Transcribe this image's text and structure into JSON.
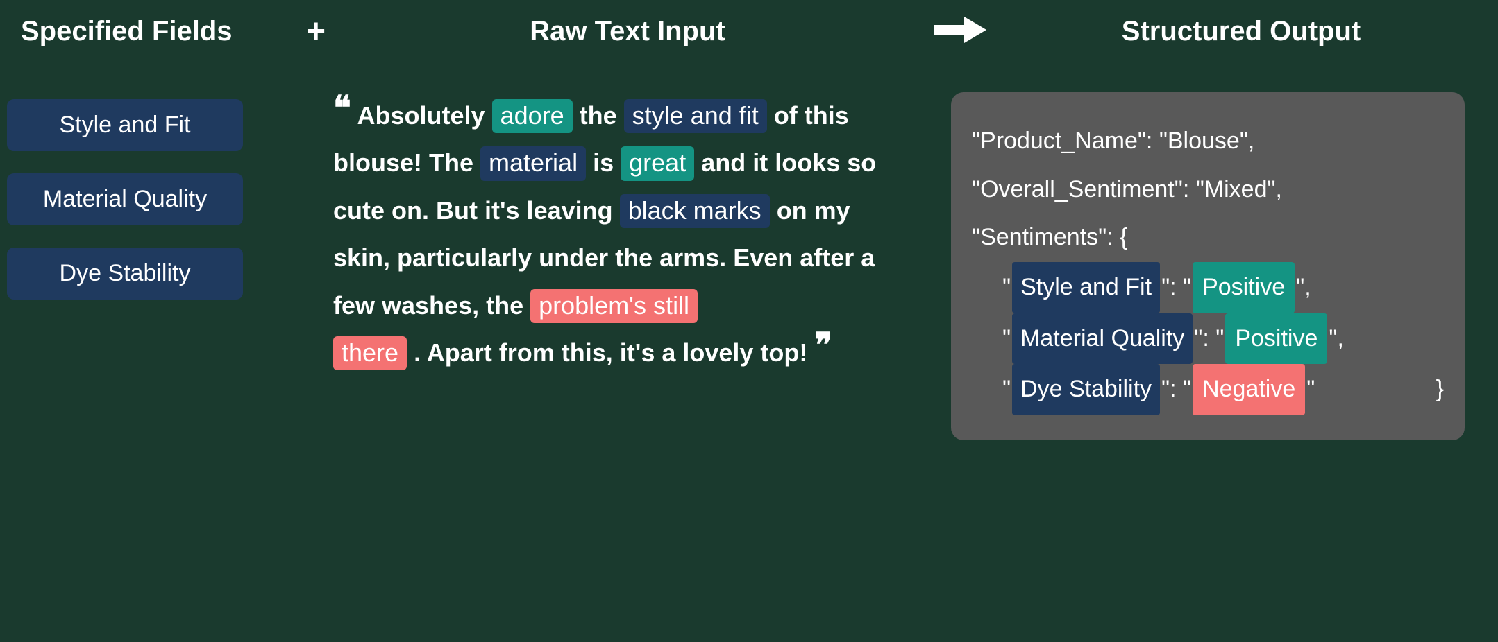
{
  "headers": {
    "fields": "Specified Fields",
    "plus": "+",
    "raw": "Raw Text Input",
    "output": "Structured Output"
  },
  "fields": [
    "Style and Fit",
    "Material Quality",
    "Dye Stability"
  ],
  "review": {
    "seg1": "Absolutely",
    "adore": "adore",
    "seg2": "the",
    "style_fit": "style and fit",
    "seg3": "of this blouse! The",
    "material": "material",
    "seg4": "is",
    "great": "great",
    "seg5": "and it looks so cute on. But it's leaving",
    "black_marks": "black marks",
    "seg6": "on my skin, particularly under the arms. Even after a few washes, the",
    "problem1": "problem's still",
    "problem2": "there",
    "seg7": ". Apart from this, it's a lovely top!"
  },
  "output": {
    "product_key": "\"Product_Name\": ",
    "product_val": "\"Blouse\",",
    "overall_key": "\"Overall_Sentiment\": ",
    "overall_val": "\"Mixed\",",
    "sentiments_open": "\"Sentiments\": {",
    "rows": [
      {
        "key": "Style and Fit",
        "val": "Positive",
        "valClass": "val-teal"
      },
      {
        "key": "Material Quality",
        "val": "Positive",
        "valClass": "val-teal"
      },
      {
        "key": "Dye Stability",
        "val": "Negative",
        "valClass": "val-coral"
      }
    ],
    "close_brace": "}"
  },
  "colors": {
    "teal": "#149483",
    "navy": "#1f3a5f",
    "coral": "#f47272",
    "panel": "#595959"
  }
}
